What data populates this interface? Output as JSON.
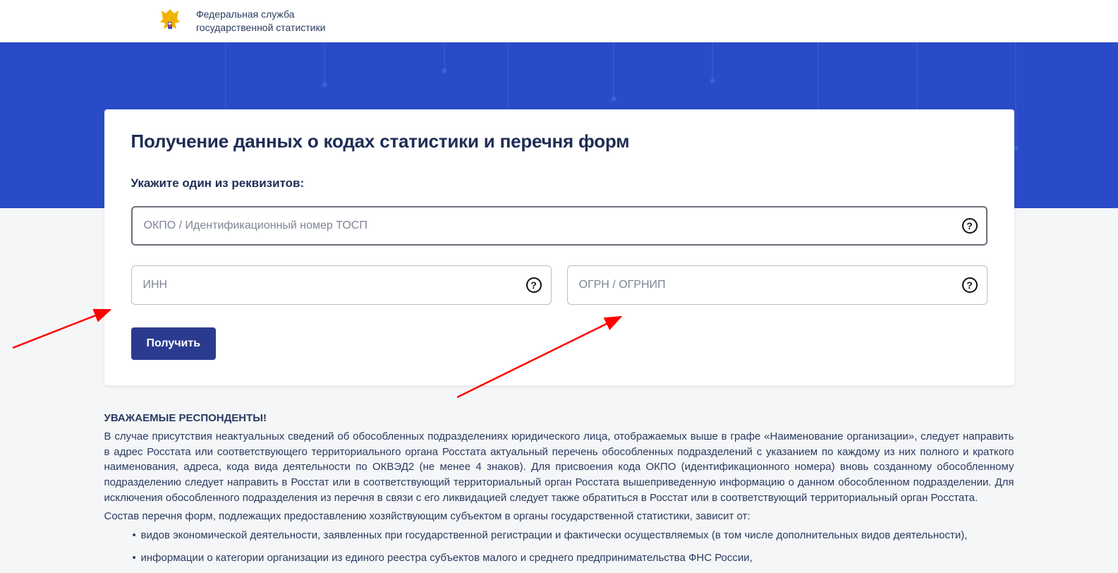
{
  "header": {
    "org_line1": "Федеральная служба",
    "org_line2": "государственной статистики"
  },
  "page": {
    "title": "Получение данных о кодах статистики и перечня форм",
    "instruction": "Укажите один из реквизитов:",
    "okpo_placeholder": "ОКПО / Идентификационный номер ТОСП",
    "inn_placeholder": "ИНН",
    "ogrn_placeholder": "ОГРН / ОГРНИП",
    "submit_label": "Получить",
    "help_glyph": "?"
  },
  "note": {
    "title": "УВАЖАЕМЫЕ РЕСПОНДЕНТЫ!",
    "body": "В случае присутствия неактуальных сведений об обособленных подразделениях юридического лица, отображаемых выше в графе «Наименование организации», следует направить в адрес Росстата или соответствующего территориального органа Росстата актуальный перечень обособленных подразделений с указанием по каждому из них полного и краткого наименования, адреса, кода вида деятельности по ОКВЭД2 (не менее 4 знаков). Для присвоения кода ОКПО (идентификационного номера) вновь созданному обособленному подразделению следует направить в Росстат или в соответствующий территориальный орган Росстата вышеприведенную информацию о данном обособленном подразделении. Для исключения обособленного подразделения из перечня в связи с его ликвидацией следует также обратиться в Росстат или в соответствующий территориальный орган Росстата.",
    "list_intro": "Состав перечня форм, подлежащих предоставлению хозяйствующим субъектом в органы государственной статистики, зависит от:",
    "list": [
      "видов экономической деятельности, заявленных при государственной регистрации и фактически осуществляемых (в том числе дополнительных видов деятельности),",
      "информации о категории организации из единого реестра субъектов малого и среднего предпринимательства ФНС России,"
    ]
  }
}
